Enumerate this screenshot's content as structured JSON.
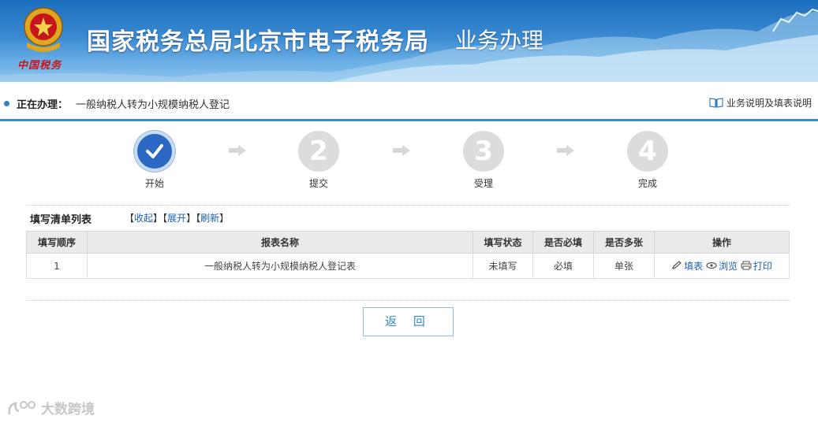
{
  "header": {
    "title": "国家税务总局北京市电子税务局",
    "subtitle": "业务办理",
    "emblem_caption": "中国税务"
  },
  "status": {
    "prefix": "正在办理：",
    "value": "一般纳税人转为小规模纳税人登记",
    "help_label": "业务说明及填表说明"
  },
  "steps": [
    {
      "label": "开始",
      "number": "",
      "state": "done"
    },
    {
      "label": "提交",
      "number": "2",
      "state": "pending"
    },
    {
      "label": "受理",
      "number": "3",
      "state": "pending"
    },
    {
      "label": "完成",
      "number": "4",
      "state": "pending"
    }
  ],
  "list": {
    "title": "填写清单列表",
    "actions": {
      "collapse": "收起",
      "expand": "展开",
      "refresh": "刷新"
    },
    "columns": [
      "填写顺序",
      "报表名称",
      "填写状态",
      "是否必填",
      "是否多张",
      "操作"
    ],
    "rows": [
      {
        "order": "1",
        "name": "一般纳税人转为小规模纳税人登记表",
        "status": "未填写",
        "required": "必填",
        "multiple": "单张",
        "ops": {
          "fill": "填表",
          "view": "浏览",
          "print": "打印"
        }
      }
    ]
  },
  "back_button": "返 回",
  "watermark": "大数跨境",
  "colors": {
    "accent": "#2a68c4",
    "link": "#1a5fb4",
    "border_accent": "#3a8bc5"
  }
}
